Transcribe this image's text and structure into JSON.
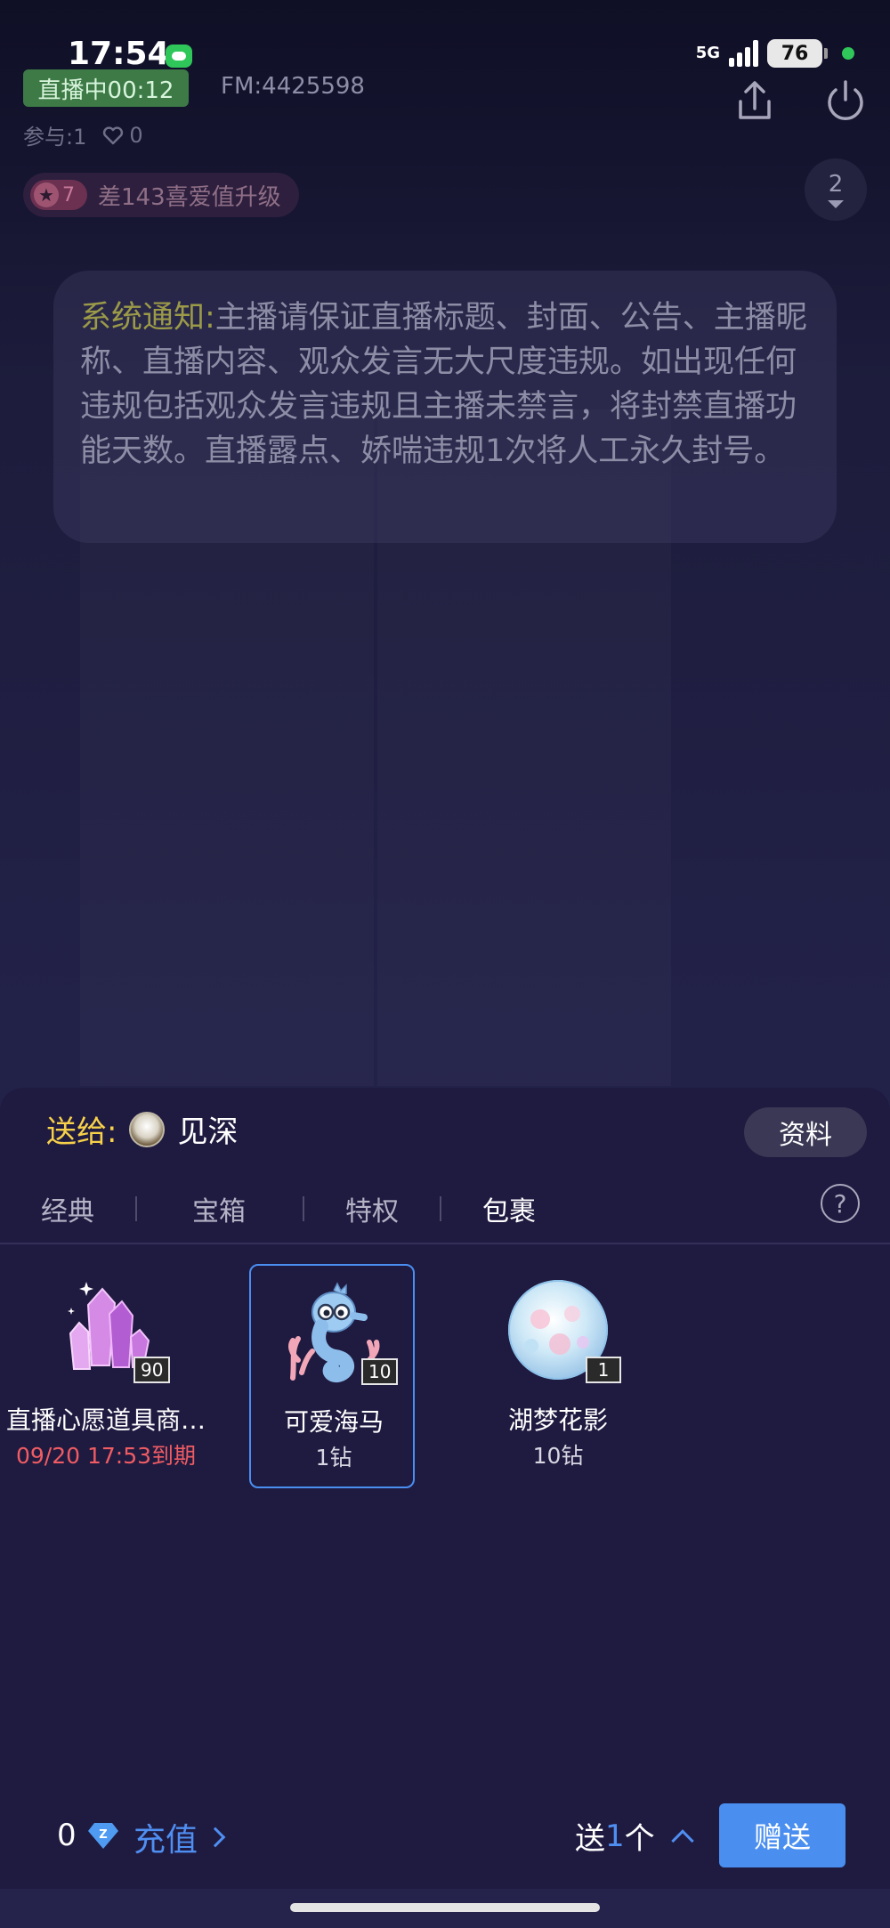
{
  "status_bar": {
    "time": "17:54",
    "network": "5G",
    "battery": "76"
  },
  "live": {
    "badge": "直播中00:12",
    "fm_id": "FM:4425598",
    "participants": "参与:1",
    "likes": "0",
    "level_value": "7",
    "level_text": "差143喜爱值升级",
    "online_count": "2"
  },
  "notice": {
    "label": "系统通知:",
    "text": "主播请保证直播标题、封面、公告、主播昵称、直播内容、观众发言无大尺度违规。如出现任何违规包括观众发言违规且主播未禁言，将封禁直播功能天数。直播露点、娇喘违规1次将人工永久封号。"
  },
  "gift_panel": {
    "send_to_label": "送给:",
    "recipient": "见深",
    "profile_button": "资料",
    "tabs": [
      "经典",
      "宝箱",
      "特权",
      "包裹"
    ],
    "active_tab": "包裹",
    "help": "?",
    "gifts": [
      {
        "name": "直播心愿道具商…",
        "sub": "09/20 17:53到期",
        "count": "90",
        "icon": "crystal-icon"
      },
      {
        "name": "可爱海马",
        "sub": "1钻",
        "count": "10",
        "icon": "seahorse-icon"
      },
      {
        "name": "湖梦花影",
        "sub": "10钻",
        "count": "1",
        "icon": "flower-bubble-icon"
      }
    ],
    "selected_index": 1
  },
  "bottom_bar": {
    "balance": "0",
    "recharge_label": "充值",
    "send_prefix": "送",
    "send_qty": "1",
    "send_suffix": "个",
    "send_button": "赠送"
  },
  "colors": {
    "accent_blue": "#4a8ff0",
    "send_to_yellow": "#f7d14a",
    "expire_red": "#ef5c63",
    "live_green": "#3d7a46"
  }
}
